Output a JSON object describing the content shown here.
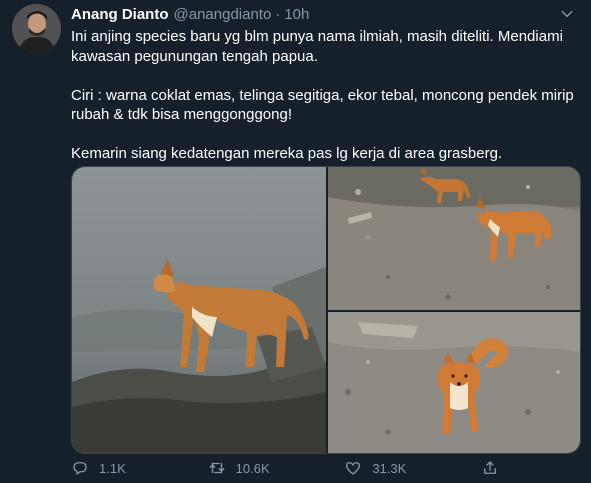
{
  "tweet": {
    "display_name": "Anang Dianto",
    "handle": "@anangdianto",
    "separator": "·",
    "time": "10h",
    "lines": [
      "Ini anjing species baru yg blm punya nama ilmiah, masih diteliti. Mendiami kawasan pegunungan tengah papua.",
      "Ciri : warna coklat emas, telinga segitiga, ekor tebal, moncong pendek mirip rubah & tdk bisa menggonggong!",
      "Kemarin siang kedatengan mereka pas lg kerja di area grasberg."
    ],
    "actions": {
      "reply_count": "1.1K",
      "retweet_count": "10.6K",
      "like_count": "31.3K"
    }
  },
  "icons": {
    "caret": "chevron-down-icon",
    "reply": "reply-icon",
    "retweet": "retweet-icon",
    "like": "heart-icon",
    "share": "share-icon"
  },
  "colors": {
    "background": "#15202b",
    "primary_text": "#ffffff",
    "secondary_text": "#8899a6",
    "border": "#38444d"
  }
}
